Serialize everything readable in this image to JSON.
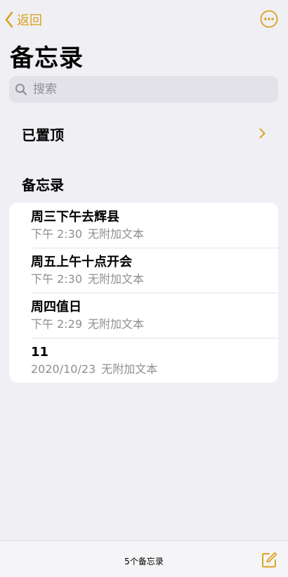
{
  "nav": {
    "back_label": "返回"
  },
  "page_title": "备忘录",
  "search": {
    "placeholder": "搜索"
  },
  "pinned": {
    "label": "已置顶"
  },
  "section": {
    "header": "备忘录"
  },
  "notes": [
    {
      "title": "周三下午去辉县",
      "date": "下午 2:30",
      "preview": "无附加文本"
    },
    {
      "title": "周五上午十点开会",
      "date": "下午 2:30",
      "preview": "无附加文本"
    },
    {
      "title": "周四值日",
      "date": "下午 2:29",
      "preview": "无附加文本"
    },
    {
      "title": "11",
      "date": "2020/10/23",
      "preview": "无附加文本"
    }
  ],
  "toolbar": {
    "count_label": "5个备忘录"
  },
  "icons": {
    "back": "chevron-left-icon",
    "more": "ellipsis-circle-icon",
    "search": "search-icon",
    "pinned": "chevron-right-icon",
    "compose": "compose-icon"
  },
  "colors": {
    "accent": "#d9a21b",
    "background": "#efeff4",
    "secondary_text": "#8e8e93"
  }
}
